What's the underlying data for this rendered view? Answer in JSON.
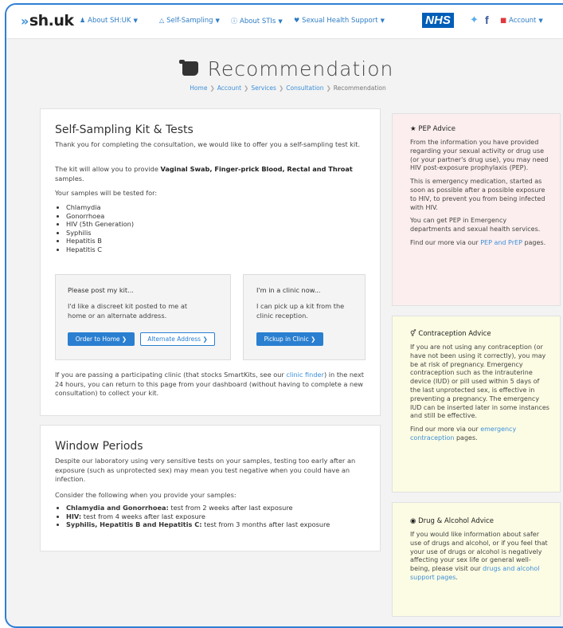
{
  "nav": {
    "brand": "sh.uk",
    "items": [
      {
        "label": "About SH:UK",
        "icon": "user-icon"
      },
      {
        "label": "Self-Sampling",
        "icon": "flask-icon"
      },
      {
        "label": "About STIs",
        "icon": "info-icon"
      },
      {
        "label": "Sexual Health Support",
        "icon": "heart-icon"
      }
    ],
    "nhs": "NHS",
    "account": "Account"
  },
  "header": {
    "title": "Recommendation",
    "breadcrumb": [
      "Home",
      "Account",
      "Services",
      "Consultation",
      "Recommendation"
    ]
  },
  "kit": {
    "title": "Self-Sampling Kit & Tests",
    "intro": "Thank you for completing the consultation, we would like to offer you a self-sampling test kit.",
    "allow_pre": "The kit will allow you to provide ",
    "allow_bold": "Vaginal Swab, Finger-prick Blood, Rectal and Throat",
    "allow_post": " samples.",
    "tested_for": "Your samples will be tested for:",
    "tests": [
      "Chlamydia",
      "Gonorrhoea",
      "HIV (5th Generation)",
      "Syphilis",
      "Hepatitis B",
      "Hepatitis C"
    ],
    "post": {
      "title": "Please post my kit...",
      "text": "I'd like a discreet kit posted to me at home or an alternate address.",
      "order_btn": "Order to Home",
      "alt_btn": "Alternate Address"
    },
    "clinic": {
      "title": "I'm in a clinic now...",
      "text": "I can pick up a kit from the clinic reception.",
      "pickup_btn": "Pickup in Clinic"
    },
    "footer_pre": "If you are passing a participating clinic (that stocks SmartKits, see our ",
    "footer_link": "clinic finder",
    "footer_post": ") in the next 24 hours, you can return to this page from your dashboard (without having to complete a new consultation) to collect your kit."
  },
  "window": {
    "title": "Window Periods",
    "intro": "Despite our laboratory using very sensitive tests on your samples, testing too early after an exposure (such as unprotected sex) may mean you test negative when you could have an infection.",
    "consider": "Consider the following when you provide your samples:",
    "items": [
      {
        "bold": "Chlamydia and Gonorrhoea:",
        "text": " test from 2 weeks after last exposure"
      },
      {
        "bold": "HIV:",
        "text": " test from 4 weeks after last exposure"
      },
      {
        "bold": "Syphilis, Hepatitis B and Hepatitis C:",
        "text": " test from 3 months after last exposure"
      }
    ]
  },
  "pep": {
    "title": "PEP Advice",
    "p1": "From the information you have provided regarding your sexual activity or drug use (or your partner's drug use), you may need HIV post-exposure prophylaxis (PEP).",
    "p2": "This is emergency medication, started as soon as possible after a possible exposure to HIV, to prevent you from being infected with HIV.",
    "p3": "You can get PEP in Emergency departments and sexual health services.",
    "p4_pre": "Find our more via our ",
    "p4_link": "PEP and PrEP",
    "p4_post": " pages."
  },
  "contraception": {
    "title": "Contraception Advice",
    "p1": "If you are not using any contraception (or have not been using it correctly), you may be at risk of pregnancy. Emergency contraception such as the intrauterine device (IUD) or pill used within 5 days of the last unprotected sex, is effective in preventing a pregnancy. The emergency IUD can be inserted later in some instances and still be effective.",
    "p2_pre": "Find our more via our ",
    "p2_link": "emergency contraception",
    "p2_post": " pages."
  },
  "drug": {
    "title": "Drug & Alcohol Advice",
    "p1_pre": "If you would like information about safer use of drugs and alcohol, or if you feel that your use of drugs or alcohol is negatively affecting your sex life or general well-being, please visit our ",
    "p1_link": "drugs and alcohol support pages",
    "p1_post": "."
  },
  "colors": {
    "accent": "#2a7fd0",
    "nhs": "#005eb8",
    "pep_bg": "#fceeee",
    "advice_bg": "#fcfce4"
  }
}
